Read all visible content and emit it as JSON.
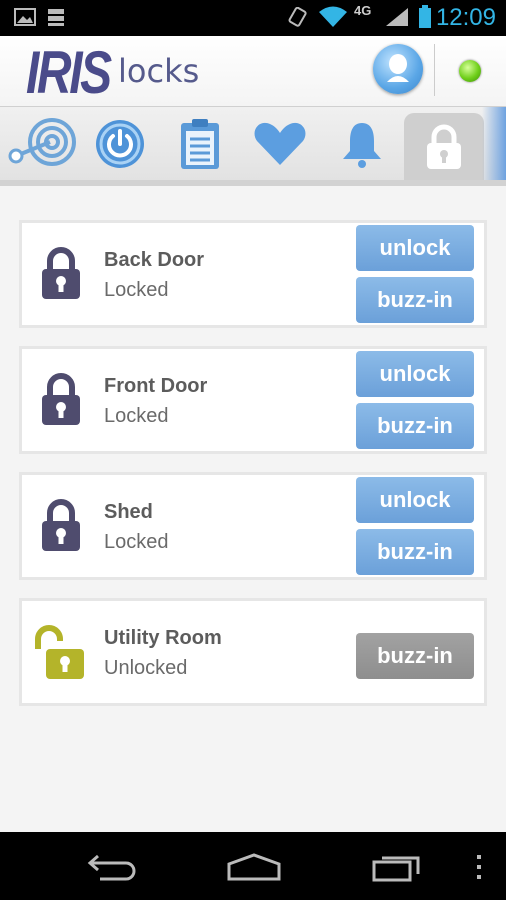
{
  "status_bar": {
    "time": "12:09",
    "network": "4G",
    "icons": [
      "gallery-icon",
      "storage-icon",
      "rotate-icon",
      "wifi-icon",
      "signal-icon",
      "battery-icon"
    ]
  },
  "header": {
    "logo_text": "IRIS",
    "section_title": "locks",
    "icons": [
      "microphone-icon",
      "connection-status-icon"
    ],
    "status_color": "#6fcf1a"
  },
  "nav": {
    "items": [
      {
        "name": "dashboard",
        "icon": "range-icon"
      },
      {
        "name": "power",
        "icon": "power-icon"
      },
      {
        "name": "history",
        "icon": "clipboard-icon"
      },
      {
        "name": "care",
        "icon": "heart-icon"
      },
      {
        "name": "alarms",
        "icon": "bell-icon"
      },
      {
        "name": "locks",
        "icon": "lock-icon",
        "active": true
      }
    ]
  },
  "devices": [
    {
      "name": "Back Door",
      "status": "Locked",
      "locked": true,
      "unlock_label": "unlock",
      "buzz_label": "buzz-in"
    },
    {
      "name": "Front Door",
      "status": "Locked",
      "locked": true,
      "unlock_label": "unlock",
      "buzz_label": "buzz-in"
    },
    {
      "name": "Shed",
      "status": "Locked",
      "locked": true,
      "unlock_label": "unlock",
      "buzz_label": "buzz-in"
    },
    {
      "name": "Utility Room",
      "status": "Unlocked",
      "locked": false,
      "buzz_label": "buzz-in"
    }
  ],
  "colors": {
    "locked_icon": "#4f4c6e",
    "unlocked_icon": "#b4b42a",
    "button_blue": "#6ba0d9",
    "button_gray": "#8e8e8e"
  },
  "android_nav": [
    "back-icon",
    "home-icon",
    "recent-apps-icon",
    "menu-icon"
  ]
}
